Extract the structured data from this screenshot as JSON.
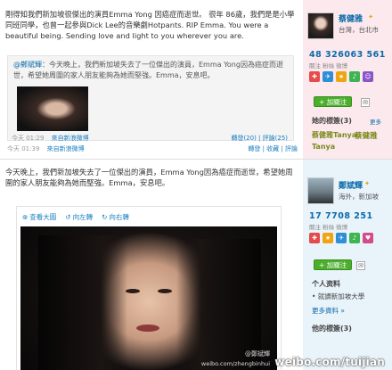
{
  "top": {
    "post_text": "剛得知我們新加坡很傑出的演員Emma Yong  因癌症而逝世。 很年  86歲，我們是是小學同班同學，也曾一起參與Dick Lee的音樂劇Hotpants. RIP Emma. You were a beautiful being. Sending love and light to you wherever you are.",
    "repost": {
      "author": "@鄭斌輝",
      "text": "：今天晚上，我們新加坡失去了一位傑出的演員，Emma Yong因為癌症而逝世，希望她周圍的家人朋友能夠為她而堅強。Emma，安息吧。",
      "time": "今天 01:29",
      "source": "來自新浪微博",
      "actions": "轉發(20) | 評論(25)"
    },
    "meta": {
      "time": "今天 01:39",
      "source": "來自新浪微博",
      "actions": "轉發 | 收藏 | 評論"
    },
    "side": {
      "username": "蔡健雅",
      "location": "台灣，台北市",
      "stats": "48  326063  561",
      "stat_labels": "關注  粉絲  微博",
      "follow_label": "+ 加關注",
      "tags_heading": "她的標簽(3)",
      "more": "更多",
      "tags": [
        "蔡健雅Tanya",
        "蔡健雅",
        "Tanya"
      ]
    }
  },
  "bottom": {
    "post_text": "今天晚上，我們新加坡失去了一位傑出的演員，Emma Yong因為癌症而逝世，希望她周圍的家人朋友能夠為她而堅強。Emma，安息吧。",
    "toolbar": {
      "view_large": "查看大圖",
      "rotate_left": "向左轉",
      "rotate_right": "向右轉"
    },
    "photo_credit": "@鄭斌輝",
    "photo_url": "weibo.com/zhengbinhui",
    "side": {
      "username": "鄭斌輝",
      "location": "海外，新加坡",
      "stats": "17  7708  251",
      "stat_labels": "關注  粉絲  微博",
      "follow_label": "+ 加關注",
      "info_heading": "个人资料",
      "school": "• 就讀新加坡大學",
      "more_info": "更多資料 »",
      "tags_heading": "他的標簽(3)"
    }
  },
  "watermark": "weibo.com/tuijian",
  "colors": {
    "link": "#0a6aa8",
    "follow_green": "#4caf2c",
    "side_pink": "#fbe9ee",
    "side_blue": "#e9f3fa"
  }
}
